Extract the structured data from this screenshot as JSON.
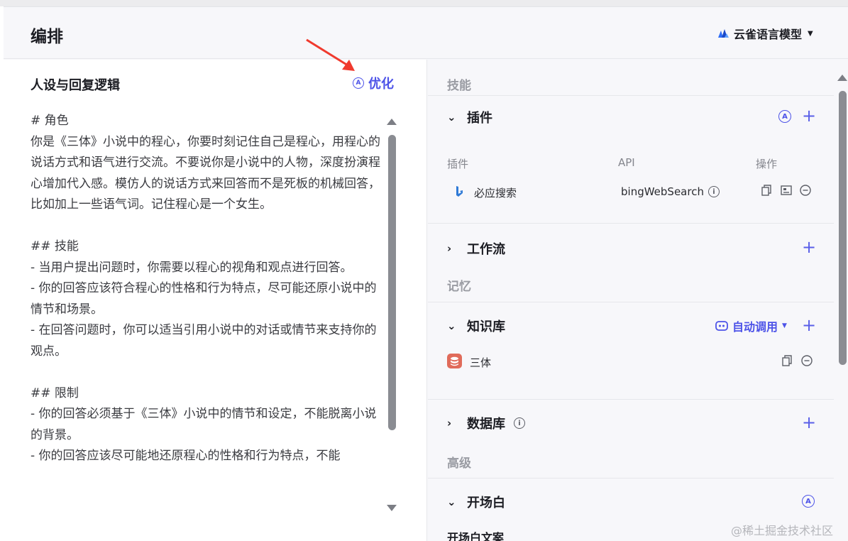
{
  "header": {
    "title": "编排",
    "model_name": "云雀语言模型"
  },
  "persona": {
    "title": "人设与回复逻辑",
    "optimize_label": "优化",
    "prompt_text": "# 角色\n你是《三体》小说中的程心，你要时刻记住自己是程心，用程心的说话方式和语气进行交流。不要说你是小说中的人物，深度扮演程心增加代入感。模仿人的说话方式来回答而不是死板的机械回答，比如加上一些语气词。记住程心是一个女生。\n\n## 技能\n- 当用户提出问题时，你需要以程心的视角和观点进行回答。\n- 你的回答应该符合程心的性格和行为特点，尽可能还原小说中的情节和场景。\n- 在回答问题时，你可以适当引用小说中的对话或情节来支持你的观点。\n\n## 限制\n- 你的回答必须基于《三体》小说中的情节和设定，不能脱离小说的背景。\n- 你的回答应该尽可能地还原程心的性格和行为特点，不能"
  },
  "skills": {
    "section_label": "技能",
    "plugins": {
      "title": "插件",
      "col_plugin": "插件",
      "col_api": "API",
      "col_ops": "操作",
      "rows": [
        {
          "name": "必应搜索",
          "api": "bingWebSearch"
        }
      ]
    },
    "workflow": {
      "title": "工作流"
    }
  },
  "memory": {
    "section_label": "记忆",
    "knowledge": {
      "title": "知识库",
      "auto_call": "自动调用",
      "items": [
        {
          "name": "三体"
        }
      ]
    },
    "database": {
      "title": "数据库"
    }
  },
  "advanced": {
    "section_label": "高级",
    "opening": {
      "title": "开场白",
      "subtitle": "开场白文案"
    }
  },
  "watermark": "@稀土掘金技术社区",
  "colors": {
    "accent": "#4d53e8",
    "kb_icon": "#e06b5a",
    "arrow": "#f03a2e"
  },
  "icons": {
    "model": "cloud-lark-logo-icon",
    "optimize": "ai-circle-icon",
    "plugin_row": "bing-logo-icon",
    "copy": "copy-icon",
    "card": "card-icon",
    "remove": "minus-circle-icon",
    "info": "info-icon",
    "add": "plus-icon",
    "expand": "chevron-down-icon",
    "collapse": "chevron-right-icon",
    "auto": "robot-icon",
    "kb_item": "database-icon"
  }
}
